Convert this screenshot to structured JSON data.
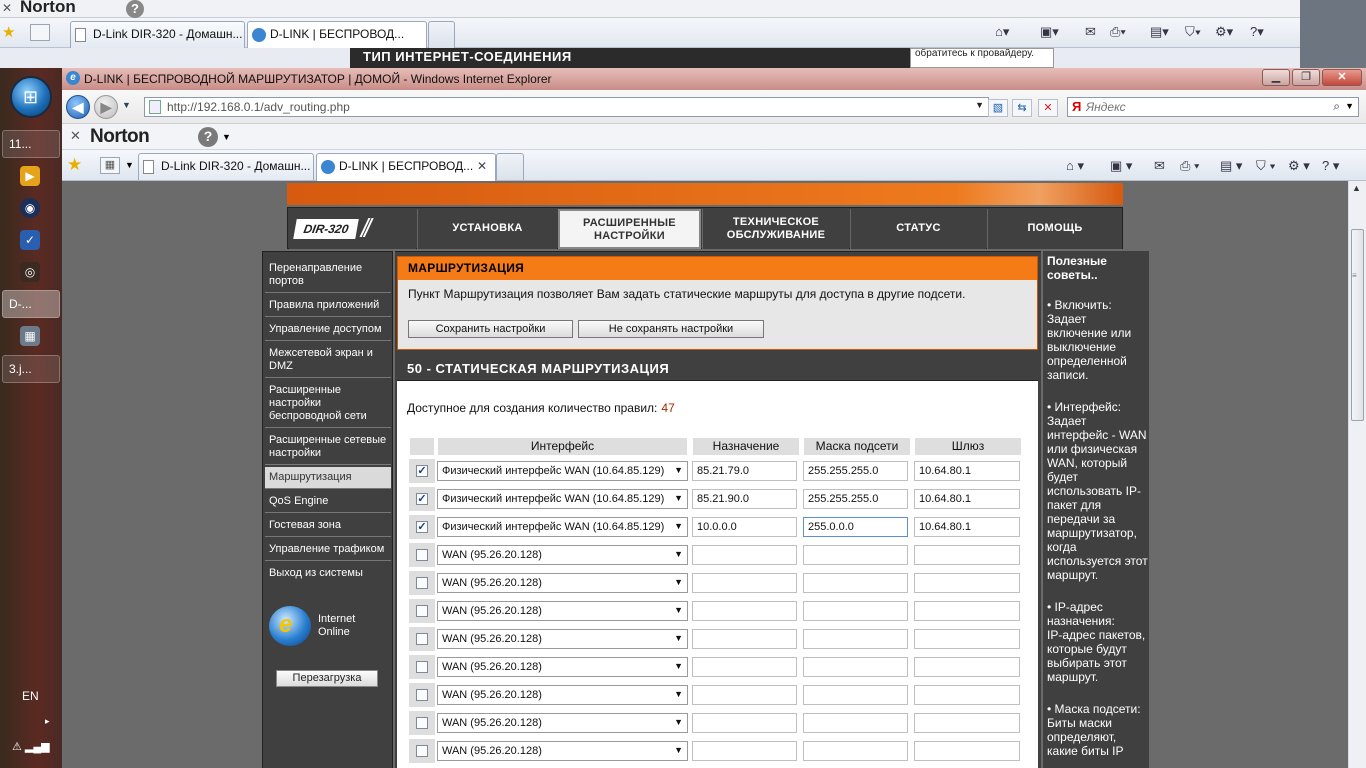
{
  "bg_window": {
    "norton_brand": "Norton",
    "tabs": [
      {
        "label": "D-Link DIR-320 - Домашн..."
      },
      {
        "label": "D-LINK | БЕСПРОВОД..."
      }
    ],
    "strip_text": "ТИП ИНТЕРНЕТ-СОЕДИНЕНИЯ",
    "strip_side_text": "обратитесь к провайдеру."
  },
  "taskbar": {
    "items": [
      {
        "label": "11..."
      },
      {
        "label": "D-..."
      },
      {
        "label": "3.j..."
      }
    ],
    "language": "EN"
  },
  "browser": {
    "title": "D-LINK | БЕСПРОВОДНОЙ МАРШРУТИЗАТОР | ДОМОЙ - Windows Internet Explorer",
    "url": "http://192.168.0.1/adv_routing.php",
    "search_placeholder": "Яндекс",
    "norton_brand": "Norton",
    "tabs": [
      {
        "label": "D-Link DIR-320 - Домашн..."
      },
      {
        "label": "D-LINK | БЕСПРОВОД..."
      }
    ]
  },
  "router": {
    "model": "DIR-320",
    "nav": [
      {
        "label": "УСТАНОВКА"
      },
      {
        "label": "РАСШИРЕННЫЕ НАСТРОЙКИ"
      },
      {
        "label": "ТЕХНИЧЕСКОЕ ОБСЛУЖИВАНИЕ"
      },
      {
        "label": "СТАТУС"
      },
      {
        "label": "ПОМОЩЬ"
      }
    ],
    "menu": [
      {
        "label": "Перенаправление портов"
      },
      {
        "label": "Правила приложений"
      },
      {
        "label": "Управление доступом"
      },
      {
        "label": "Межсетевой экран и DMZ"
      },
      {
        "label": "Расширенные настройки беспроводной сети"
      },
      {
        "label": "Расширенные сетевые настройки"
      },
      {
        "label": "Маршрутизация"
      },
      {
        "label": "QoS Engine"
      },
      {
        "label": "Гостевая зона"
      },
      {
        "label": "Управление трафиком"
      },
      {
        "label": "Выход из системы"
      }
    ],
    "ie_online": {
      "line1": "Internet",
      "line2": "Online"
    },
    "reboot_label": "Перезагрузка",
    "routing": {
      "title": "МАРШРУТИЗАЦИЯ",
      "description": "Пункт Маршрутизация позволяет Вам задать статические маршруты для доступа в другие подсети.",
      "save_label": "Сохранить настройки",
      "cancel_label": "Не сохранять настройки"
    },
    "static_routes": {
      "title": "50 - СТАТИЧЕСКАЯ МАРШРУТИЗАЦИЯ",
      "available_label": "Доступное для создания количество правил:",
      "available_count": "47",
      "columns": [
        "Интерфейс",
        "Назначение",
        "Маска подсети",
        "Шлюз"
      ],
      "rows": [
        {
          "enabled": true,
          "interface": "Физический интерфейс WAN (10.64.85.129)",
          "destination": "85.21.79.0",
          "mask": "255.255.255.0",
          "gateway": "10.64.80.1"
        },
        {
          "enabled": true,
          "interface": "Физический интерфейс WAN (10.64.85.129)",
          "destination": "85.21.90.0",
          "mask": "255.255.255.0",
          "gateway": "10.64.80.1"
        },
        {
          "enabled": true,
          "interface": "Физический интерфейс WAN (10.64.85.129)",
          "destination": "10.0.0.0",
          "mask": "255.0.0.0",
          "gateway": "10.64.80.1"
        },
        {
          "enabled": false,
          "interface": "WAN (95.26.20.128)",
          "destination": "",
          "mask": "",
          "gateway": ""
        },
        {
          "enabled": false,
          "interface": "WAN (95.26.20.128)",
          "destination": "",
          "mask": "",
          "gateway": ""
        },
        {
          "enabled": false,
          "interface": "WAN (95.26.20.128)",
          "destination": "",
          "mask": "",
          "gateway": ""
        },
        {
          "enabled": false,
          "interface": "WAN (95.26.20.128)",
          "destination": "",
          "mask": "",
          "gateway": ""
        },
        {
          "enabled": false,
          "interface": "WAN (95.26.20.128)",
          "destination": "",
          "mask": "",
          "gateway": ""
        },
        {
          "enabled": false,
          "interface": "WAN (95.26.20.128)",
          "destination": "",
          "mask": "",
          "gateway": ""
        },
        {
          "enabled": false,
          "interface": "WAN (95.26.20.128)",
          "destination": "",
          "mask": "",
          "gateway": ""
        },
        {
          "enabled": false,
          "interface": "WAN (95.26.20.128)",
          "destination": "",
          "mask": "",
          "gateway": ""
        }
      ]
    },
    "hints": {
      "title": "Полезные советы..",
      "items": [
        {
          "text": "• Включить:\nЗадает включение или выключение определенной записи."
        },
        {
          "text": "• Интерфейс:\nЗадает интерфейс - WAN или физическая WAN, который будет использовать IP-пакет для передачи за маршрутизатор, когда используется этот маршрут."
        },
        {
          "text": "• IP-адрес назначения:\nIP-адрес пакетов, которые будут выбирать этот маршрут."
        },
        {
          "text": "• Маска подсети:\nБиты маски определяют, какие биты IP"
        }
      ]
    }
  }
}
